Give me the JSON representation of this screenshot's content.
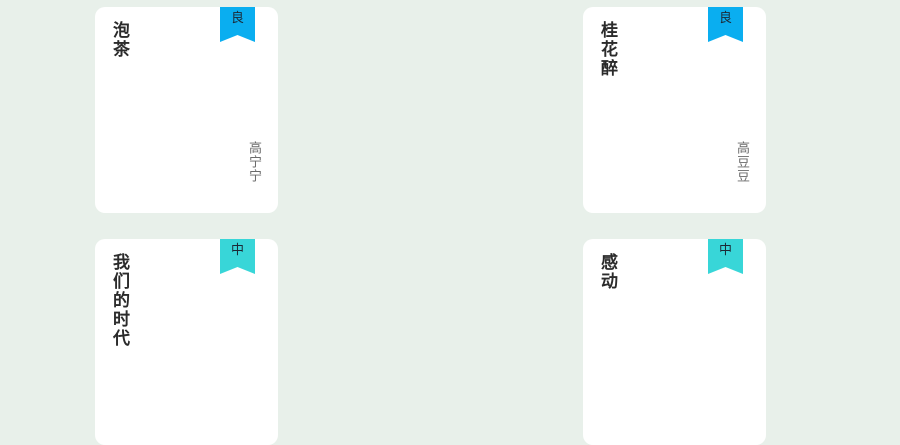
{
  "colors": {
    "background": "#e8f0ea",
    "card": "#ffffff",
    "grade_good": "#0aaef0",
    "grade_medium": "#38d6d8"
  },
  "cards": [
    {
      "title": "泡茶",
      "author": "高宁宁",
      "grade": "良",
      "grade_color": "#0aaef0"
    },
    {
      "title": "桂花醉",
      "author": "高豆豆",
      "grade": "良",
      "grade_color": "#0aaef0"
    },
    {
      "title": "我们的时代",
      "author": "",
      "grade": "中",
      "grade_color": "#38d6d8"
    },
    {
      "title": "感动",
      "author": "",
      "grade": "中",
      "grade_color": "#38d6d8"
    }
  ]
}
